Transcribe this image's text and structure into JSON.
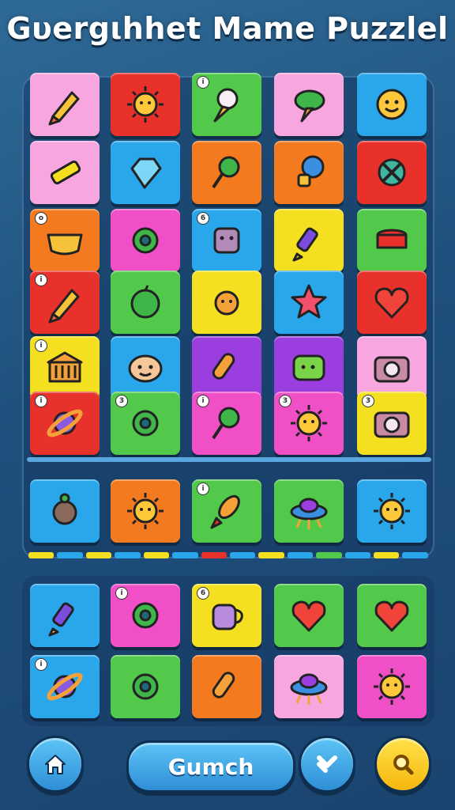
{
  "header": {
    "title": "Gυergιhhet Mame Puzzlel"
  },
  "board": {
    "rows": [
      [
        {
          "icon": "pencil-icon",
          "color": "#f7a6e0",
          "badge": ""
        },
        {
          "icon": "sun-icon",
          "color": "#e8312b",
          "badge": ""
        },
        {
          "icon": "ice-cream-icon",
          "color": "#52c94a",
          "badge": "i"
        },
        {
          "icon": "leaf-cone-icon",
          "color": "#f7a6e0",
          "badge": ""
        },
        {
          "icon": "smiley-icon",
          "color": "#2aa6ea",
          "badge": ""
        }
      ],
      [
        {
          "icon": "crayon-icon",
          "color": "#f7a6e0",
          "badge": ""
        },
        {
          "icon": "diamond-icon",
          "color": "#2aa6ea",
          "badge": ""
        },
        {
          "icon": "pin-icon",
          "color": "#f47a1f",
          "badge": ""
        },
        {
          "icon": "lightbulb-icon",
          "color": "#f47a1f",
          "badge": ""
        },
        {
          "icon": "cross-circle-icon",
          "color": "#e8312b",
          "badge": ""
        }
      ],
      [
        {
          "icon": "bowl-icon",
          "color": "#f47a1f",
          "badge": "o"
        },
        {
          "icon": "gear-icon",
          "color": "#f04fc6",
          "badge": ""
        },
        {
          "icon": "robot-icon",
          "color": "#2aa6ea",
          "badge": "6"
        },
        {
          "icon": "pen-icon",
          "color": "#f4e020",
          "badge": ""
        },
        {
          "icon": "drum-icon",
          "color": "#52c94a",
          "badge": ""
        }
      ],
      [
        {
          "icon": "pencil-icon",
          "color": "#e8312b",
          "badge": "i"
        },
        {
          "icon": "apple-icon",
          "color": "#52c94a",
          "badge": ""
        },
        {
          "icon": "critter-icon",
          "color": "#f4e020",
          "badge": ""
        },
        {
          "icon": "star-icon",
          "color": "#2aa6ea",
          "badge": ""
        },
        {
          "icon": "heart-icon",
          "color": "#e8312b",
          "badge": ""
        }
      ],
      [
        {
          "icon": "building-icon",
          "color": "#f4e020",
          "badge": "i"
        },
        {
          "icon": "face-icon",
          "color": "#2aa6ea",
          "badge": ""
        },
        {
          "icon": "brush-icon",
          "color": "#9b3ee0",
          "badge": ""
        },
        {
          "icon": "block-face-icon",
          "color": "#9b3ee0",
          "badge": ""
        },
        {
          "icon": "camera-icon",
          "color": "#f7a6e0",
          "badge": ""
        }
      ],
      [
        {
          "icon": "planet-icon",
          "color": "#e8312b",
          "badge": "i"
        },
        {
          "icon": "gear-icon",
          "color": "#52c94a",
          "badge": "3"
        },
        {
          "icon": "pin-icon",
          "color": "#f04fc6",
          "badge": "i"
        },
        {
          "icon": "sun-icon",
          "color": "#f04fc6",
          "badge": "3"
        },
        {
          "icon": "camera-icon",
          "color": "#f4e020",
          "badge": "3"
        }
      ]
    ],
    "shelf": [
      {
        "icon": "turtle-icon",
        "color": "#2aa6ea",
        "badge": ""
      },
      {
        "icon": "sun-icon",
        "color": "#f47a1f",
        "badge": ""
      },
      {
        "icon": "rocket-icon",
        "color": "#52c94a",
        "badge": "i"
      },
      {
        "icon": "ufo-icon",
        "color": "#52c94a",
        "badge": ""
      },
      {
        "icon": "sun-icon",
        "color": "#2aa6ea",
        "badge": ""
      }
    ],
    "progress_colors": [
      "#f4e020",
      "#2aa6ea",
      "#f4e020",
      "#2aa6ea",
      "#f4e020",
      "#2aa6ea",
      "#e8312b",
      "#2aa6ea",
      "#f4e020",
      "#2aa6ea",
      "#52c94a",
      "#2aa6ea",
      "#f4e020",
      "#2aa6ea"
    ]
  },
  "tray": {
    "rows": [
      [
        {
          "icon": "pen-icon",
          "color": "#2aa6ea",
          "badge": ""
        },
        {
          "icon": "gear-icon",
          "color": "#f04fc6",
          "badge": "i"
        },
        {
          "icon": "mug-icon",
          "color": "#f4e020",
          "badge": "6"
        },
        {
          "icon": "heart-icon",
          "color": "#52c94a",
          "badge": ""
        },
        {
          "icon": "heart-icon",
          "color": "#52c94a",
          "badge": ""
        }
      ],
      [
        {
          "icon": "planet-icon",
          "color": "#2aa6ea",
          "badge": "i"
        },
        {
          "icon": "gear-icon",
          "color": "#52c94a",
          "badge": ""
        },
        {
          "icon": "brush-icon",
          "color": "#f47a1f",
          "badge": ""
        },
        {
          "icon": "ufo-icon",
          "color": "#f7a6e0",
          "badge": ""
        },
        {
          "icon": "sun-icon",
          "color": "#f04fc6",
          "badge": ""
        }
      ]
    ]
  },
  "footer": {
    "home_icon": "home-icon",
    "main_button_label": "Gumch",
    "shuffle_icon": "shuffle-icon",
    "search_icon": "search-icon"
  }
}
